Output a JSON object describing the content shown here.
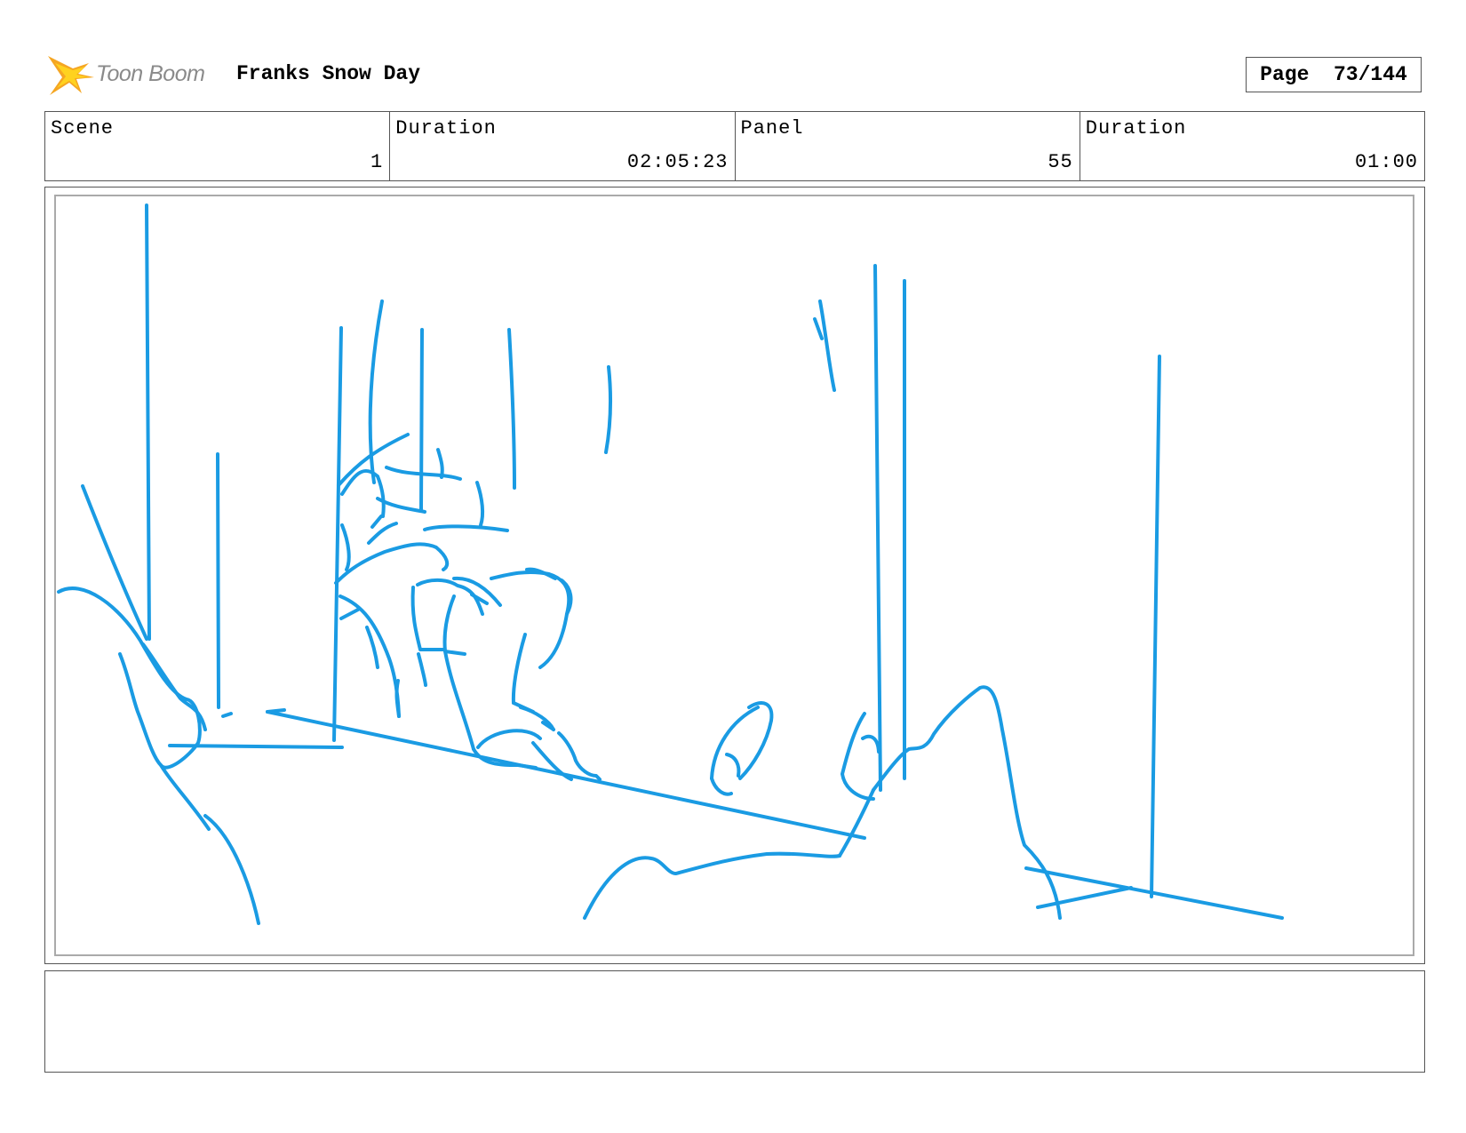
{
  "header": {
    "logo_text": "Toon Boom",
    "title": "Franks Snow Day",
    "page_label": "Page",
    "page_value": "73/144"
  },
  "info": {
    "scene_label": "Scene",
    "scene_value": "1",
    "duration_label": "Duration",
    "duration_value": "02:05:23",
    "panel_label": "Panel",
    "panel_value": "55",
    "panel_duration_label": "Duration",
    "panel_duration_value": "01:00"
  },
  "colors": {
    "sketch": "#1a9be3",
    "logo_orange": "#f5a623",
    "logo_yellow": "#ffd21f"
  },
  "icons": [
    "toon-boom-star-logo"
  ]
}
